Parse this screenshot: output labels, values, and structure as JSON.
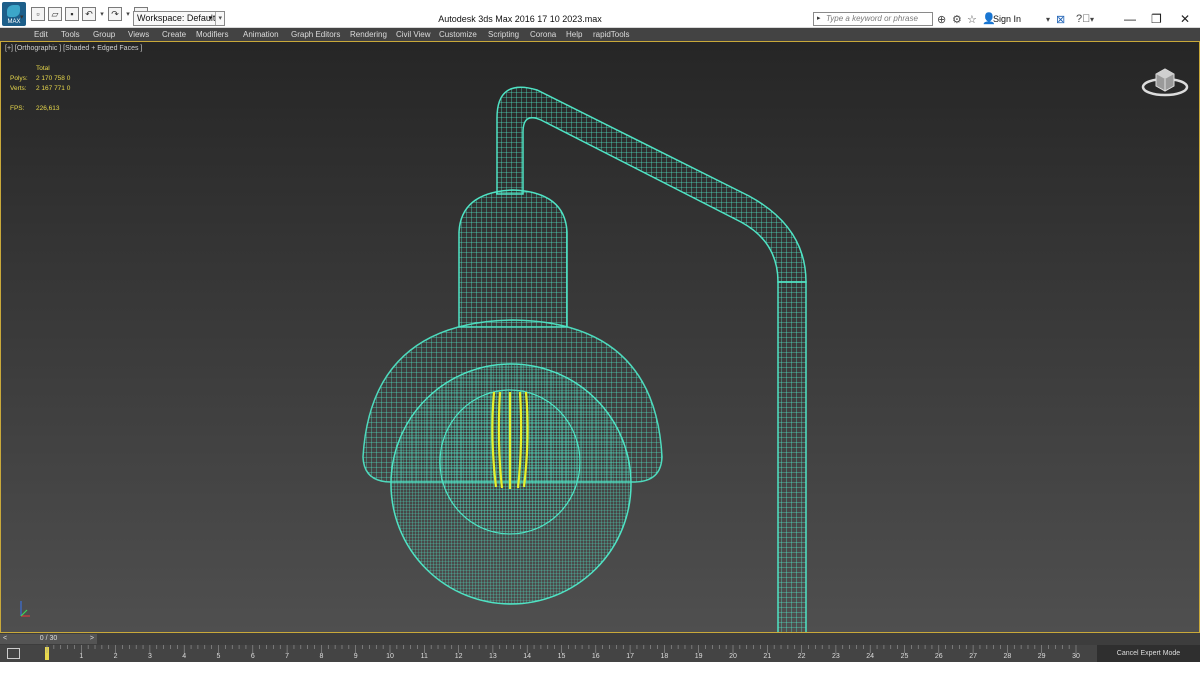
{
  "titlebar": {
    "app_badge": "MAX",
    "workspace_label": "Workspace: Default",
    "window_title": "Autodesk 3ds Max 2016    17 10 2023.max",
    "search_placeholder": "Type a keyword or phrase",
    "sign_in_label": "Sign In"
  },
  "menu": {
    "items": [
      "Edit",
      "Tools",
      "Group",
      "Views",
      "Create",
      "Modifiers",
      "Animation",
      "Graph Editors",
      "Rendering",
      "Civil View",
      "Customize",
      "Scripting",
      "Corona",
      "Help",
      "rapidTools"
    ]
  },
  "viewport": {
    "label": "[+] [Orthographic ] [Shaded + Edged Faces ]",
    "stats": {
      "header": "Total",
      "polys_label": "Polys:",
      "polys_value": "2 170 758  0",
      "verts_label": "Verts:",
      "verts_value": "2 167 771  0",
      "fps_label": "FPS:",
      "fps_value": "226,613"
    },
    "wire_color": "#4fe3c4",
    "filament_color": "#e8f02a"
  },
  "timeline": {
    "frame_display": "0 / 30",
    "ticks": [
      "1",
      "2",
      "3",
      "4",
      "5",
      "6",
      "7",
      "8",
      "9",
      "10",
      "11",
      "12",
      "13",
      "14",
      "15",
      "16",
      "17",
      "18",
      "19",
      "20",
      "21",
      "22",
      "23",
      "24",
      "25",
      "26",
      "27",
      "28",
      "29",
      "30"
    ],
    "cancel_expert_label": "Cancel Expert Mode"
  }
}
